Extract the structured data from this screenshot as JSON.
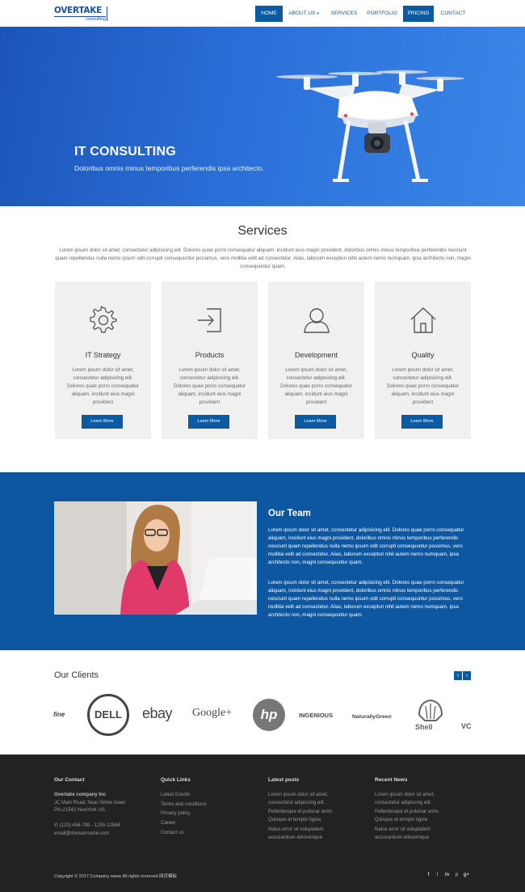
{
  "header": {
    "logo_main": "OVERTAKE",
    "logo_sub": "consulting",
    "nav": [
      {
        "label": "HOME",
        "active": true
      },
      {
        "label": "ABOUT US",
        "active": false
      },
      {
        "label": "SERVICES",
        "active": false
      },
      {
        "label": "PORTFOLIO",
        "active": false
      },
      {
        "label": "PRICING",
        "active": true
      },
      {
        "label": "CONTACT",
        "active": false
      }
    ]
  },
  "hero": {
    "title": "IT CONSULTING",
    "subtitle": "Doloribus omnis minus temporibus perferendis ipsa architecto."
  },
  "services": {
    "title": "Services",
    "intro": "Lorem ipsum dolor sit amet, consectetur adipisicing elit. Dolores quae porro consequatur aliquam, incidunt eius magni provident, doloribus omnis minus temporibus perferendis nesciunt quam repellendus nulla nemo ipsum odit corrupti consequuntur possimus, vero mollitia velit ad consectetur. Alias, laborum excepturi nihil autem nemo numquam, ipsa architecto non, magni consequuntur quam.",
    "cards": [
      {
        "title": "IT Strategy",
        "icon": "gear-icon",
        "text": "Lorem ipsum dolor sit amet, consectetur adipisicing elit. Dolores quae porro consequatur aliquam, incidunt eius magni provident",
        "button": "Learn More"
      },
      {
        "title": "Products",
        "icon": "sign-in-icon",
        "text": "Lorem ipsum dolor sit amet, consectetur adipisicing elit. Dolores quae porro consequatur aliquam, incidunt eius magni provident",
        "button": "Learn More"
      },
      {
        "title": "Development",
        "icon": "user-icon",
        "text": "Lorem ipsum dolor sit amet, consectetur adipisicing elit. Dolores quae porro consequatur aliquam, incidunt eius magni provident",
        "button": "Learn More"
      },
      {
        "title": "Quality",
        "icon": "home-icon",
        "text": "Lorem ipsum dolor sit amet, consectetur adipisicing elit. Dolores quae porro consequatur aliquam, incidunt eius magni provident",
        "button": "Learn More"
      }
    ]
  },
  "team": {
    "title": "Our Team",
    "paragraph_1": "Lorem ipsum dolor sit amet, consectetur adipisicing elit. Dolores quae porro consequatur aliquam, incidunt eius magni provident, doloribus omnis minus temporibus perferendis nesciunt quam repellendus nulla nemo ipsum odit corrupti consequuntur possimus, vero mollitia velit ad consectetur. Alias, laborum excepturi nihil autem nemo numquam, ipsa architecto non, magni consequuntur quam.",
    "paragraph_2": "Lorem ipsum dolor sit amet, consectetur adipisicing elit. Dolores quae porro consequatur aliquam, incidunt eius magni provident, doloribus omnis minus temporibus perferendis nesciunt quam repellendus nulla nemo ipsum odit corrupti consequuntur possimus, vero mollitia velit ad consectetur. Alias, laborum excepturi nihil autem nemo numquam, ipsa architecto non, magni consequuntur quam."
  },
  "clients": {
    "title": "Our Clients",
    "prev_icon": "chevron-left-icon",
    "next_icon": "chevron-right-icon",
    "logos": [
      "fine",
      "DELL",
      "ebay",
      "Google+",
      "hp",
      "INGENIOUS",
      "NaturallyGreen",
      "Shell",
      "VC"
    ]
  },
  "footer": {
    "contact": {
      "heading": "Our Contact",
      "company": "Overtake company Inc",
      "address_1": "JC Main Road, Near Silnile tower",
      "address_2": "Pin-21542 NewYork US.",
      "phone": "(123) 456-789 - 1255-12584",
      "email": "email@domainname.com"
    },
    "quick_links": {
      "heading": "Quick Links",
      "items": [
        "Latest Events",
        "Terms and conditions",
        "Privacy policy",
        "Career",
        "Contact us"
      ]
    },
    "latest_posts": {
      "heading": "Latest posts",
      "items": [
        "Lorem ipsum dolor sit amet,",
        "consectetur adipiscing elit.",
        "Pellentesque et pulvinar enim.",
        "Quisque at tempor ligula",
        "Natus error sit voluptatem",
        "accusantium doloremque"
      ]
    },
    "recent_news": {
      "heading": "Recent News",
      "items": [
        "Lorem ipsum dolor sit amet,",
        "consectetur adipiscing elit.",
        "Pellentesque et pulvinar enim.",
        "Quisque at tempor ligula",
        "Natus error sit voluptatem",
        "accusantium doloremque"
      ]
    },
    "copyright": "Copyright © 2017.Company name All rights reserved.网页模板",
    "social": [
      "f",
      "t",
      "in",
      "p",
      "g+"
    ]
  }
}
